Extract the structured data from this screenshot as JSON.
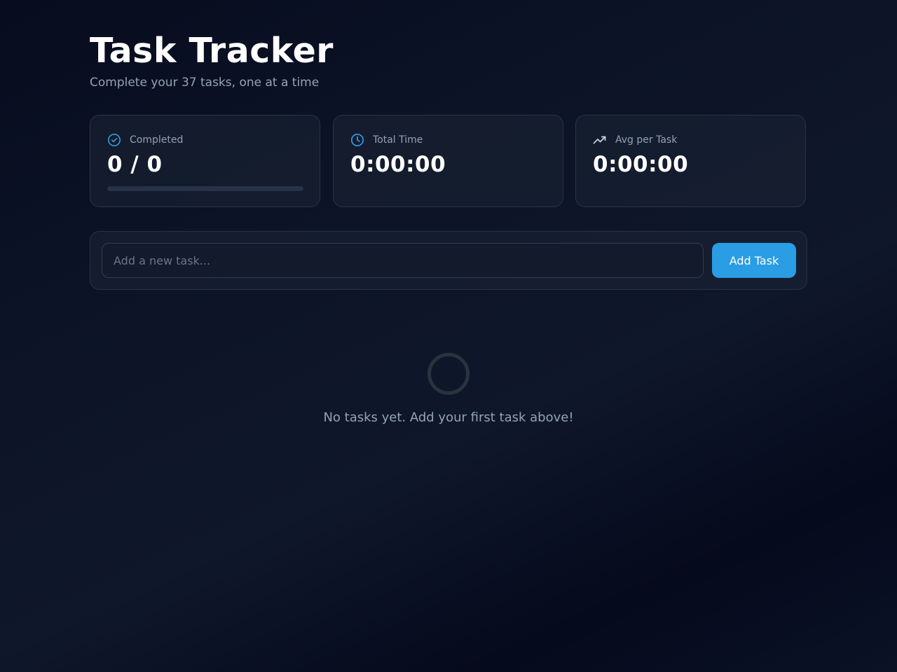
{
  "header": {
    "title": "Task Tracker",
    "subtitle": "Complete your 37 tasks, one at a time"
  },
  "stats": {
    "completed": {
      "icon": "check-circle-icon",
      "label": "Completed",
      "value": "0 / 0",
      "progress_percent": 0
    },
    "total_time": {
      "icon": "clock-icon",
      "label": "Total Time",
      "value": "0:00:00"
    },
    "avg_per_task": {
      "icon": "trending-up-icon",
      "label": "Avg per Task",
      "value": "0:00:00"
    }
  },
  "add_task": {
    "placeholder": "Add a new task...",
    "value": "",
    "button_label": "Add Task"
  },
  "empty_state": {
    "icon": "empty-ring-icon",
    "message": "No tasks yet. Add your first task above!"
  },
  "colors": {
    "accent": "#2a9de4",
    "background": "#0b1223",
    "muted_text": "#94a3b8"
  }
}
